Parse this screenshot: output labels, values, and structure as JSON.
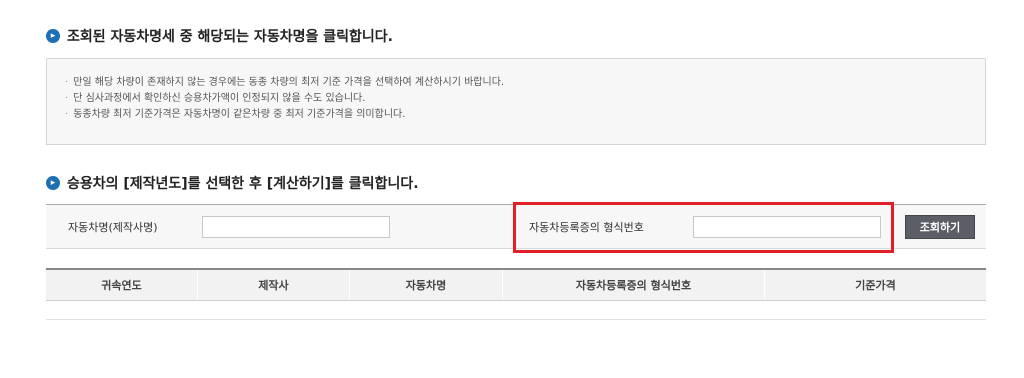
{
  "section1": {
    "title": "조회된 자동차명세 중 해당되는 자동차명을 클릭합니다."
  },
  "notices": [
    "만일 해당 차량이 존재하지 않는 경우에는 동종 차량의 최저 기준 가격을 선택하여 계산하시기 바랍니다.",
    "단 심사과정에서 확인하신 승용차가액이 인정되지 않을 수도 있습니다.",
    "동종차량 최저 기준가격은 자동차명이 같은차량 중  최저 기준가격을 의미합니다."
  ],
  "section2": {
    "title": "승용차의 [제작년도]를 선택한 후 [계산하기]를 클릭합니다."
  },
  "search": {
    "vehicle_name_label": "자동차명(제작사명)",
    "vehicle_name_value": "",
    "registration_type_label": "자동차등록증의 형식번호",
    "registration_type_value": "",
    "button_label": "조회하기"
  },
  "table": {
    "headers": [
      "귀속연도",
      "제작사",
      "자동차명",
      "자동차등록증의 형식번호",
      "기준가격"
    ]
  },
  "icons": {
    "section_bullet": "circle-arrow-right-icon"
  },
  "colors": {
    "accent": "#1f6fb5",
    "highlight": "#e01f26",
    "button": "#5b5e66"
  }
}
